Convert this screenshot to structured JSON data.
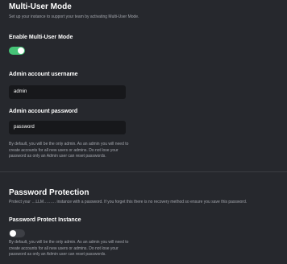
{
  "multi_user": {
    "title": "Multi-User Mode",
    "description": "Set up your instance to support your team by activating Multi-User Mode.",
    "enable_label": "Enable Multi-User Mode",
    "enabled": true,
    "username_label": "Admin account username",
    "username_value": "admin",
    "password_label": "Admin account password",
    "password_value": "password",
    "help_lines": [
      "By default, you will be the only admin. As an admin you will need to",
      "create accounts for all new users or admins. Do not lose your",
      "password as only an Admin user can reset passwords."
    ]
  },
  "password_protection": {
    "title": "Password Protection",
    "description": "Protect your …LLM……… instance with a password. If you forget this there is no recovery method so ensure you save this password.",
    "protect_label": "Password Protect Instance",
    "enabled": false,
    "help_lines": [
      "By default, you will be the only admin. As an admin you will need to",
      "create accounts for all new users or admins. Do not lose your",
      "password as only an Admin user can reset passwords."
    ]
  },
  "colors": {
    "background": "#26282d",
    "input_background": "#17181b",
    "toggle_on": "#46c477",
    "toggle_off": "#3d3f45",
    "muted_text": "#a3a6ad"
  }
}
